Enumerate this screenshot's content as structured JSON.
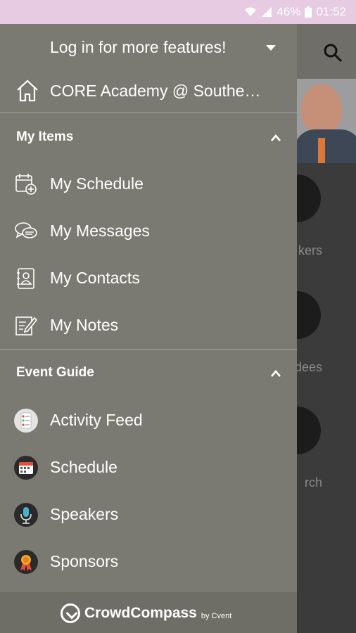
{
  "status_bar": {
    "battery": "46%",
    "time": "01:52",
    "icons": [
      "wifi-icon",
      "signal-icon",
      "battery-icon"
    ]
  },
  "background_app": {
    "labels": [
      "kers",
      "dees",
      "rch"
    ],
    "icons": [
      "search-icon"
    ]
  },
  "drawer": {
    "login_text": "Log in for more features!",
    "event_name": "CORE Academy @ Southe…",
    "sections": [
      {
        "title": "My Items",
        "items": [
          {
            "label": "My Schedule",
            "icon": "calendar-add-icon"
          },
          {
            "label": "My Messages",
            "icon": "chat-bubbles-icon"
          },
          {
            "label": "My Contacts",
            "icon": "contact-book-icon"
          },
          {
            "label": "My Notes",
            "icon": "note-edit-icon"
          }
        ]
      },
      {
        "title": "Event Guide",
        "items": [
          {
            "label": "Activity Feed",
            "icon": "activity-feed-icon"
          },
          {
            "label": "Schedule",
            "icon": "schedule-icon"
          },
          {
            "label": "Speakers",
            "icon": "microphone-icon"
          },
          {
            "label": "Sponsors",
            "icon": "ribbon-icon"
          }
        ]
      }
    ],
    "footer": {
      "brand": "CrowdCompass",
      "by": "by Cvent"
    }
  },
  "colors": {
    "status_bar_bg": "#e6cbe2",
    "drawer_bg": "#7a7a72",
    "text": "#ffffff"
  }
}
